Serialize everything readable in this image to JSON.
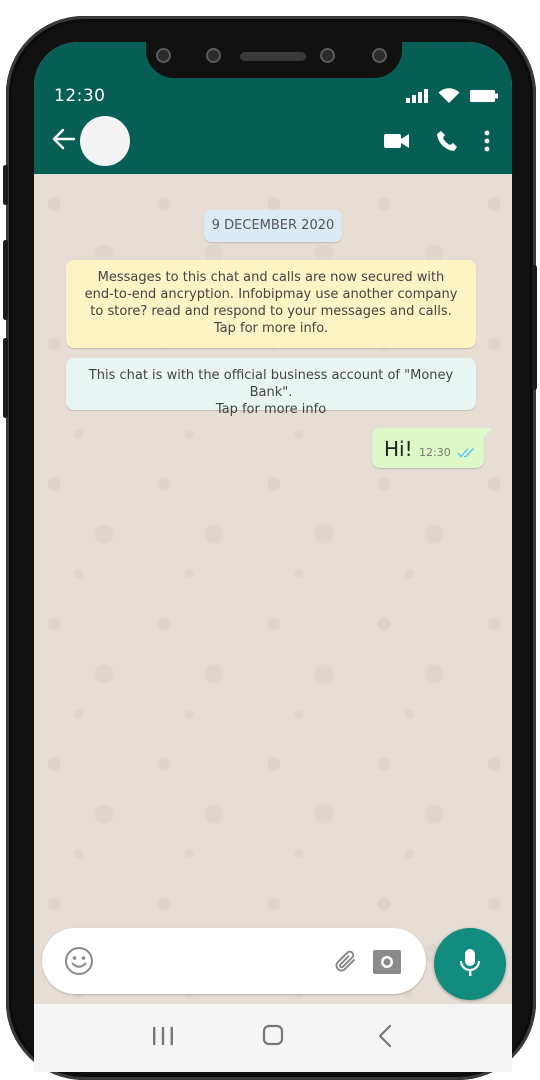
{
  "status_bar": {
    "time": "12:30",
    "icons": [
      "signal-icon",
      "wifi-icon",
      "battery-icon"
    ]
  },
  "header": {
    "icons": [
      "back-arrow-icon",
      "avatar",
      "video-call-icon",
      "voice-call-icon",
      "more-vert-icon"
    ]
  },
  "chat": {
    "date_chip": "9 DECEMBER 2020",
    "encryption_notice": {
      "line1": "Messages to this chat and calls are now secured with",
      "line2": "end-to-end ancryption. Infobipmay use another company",
      "line3": "to store? read and respond to your messages and calls.",
      "line4": "Tap for more info."
    },
    "business_notice": {
      "line1": "This chat is with the official business account of \"Money Bank\".",
      "line2": "Tap for more info"
    },
    "messages": [
      {
        "text": "Hi!",
        "time": "12:30",
        "status": "read",
        "direction": "outgoing"
      }
    ]
  },
  "composer": {
    "icons": [
      "emoji-icon",
      "attach-icon",
      "camera-icon",
      "mic-icon"
    ]
  },
  "nav_bar": {
    "icons": [
      "recent-apps-icon",
      "home-icon",
      "back-icon"
    ]
  },
  "colors": {
    "header": "#075e54",
    "chat_background": "#e6ddd4",
    "outgoing_bubble": "#dcf8c6",
    "date_chip": "#dcebf3",
    "encryption_notice": "#fcf4c4",
    "business_notice": "#e9f5f2",
    "mic_button": "#128c7e",
    "read_ticks": "#4fc3f7"
  }
}
